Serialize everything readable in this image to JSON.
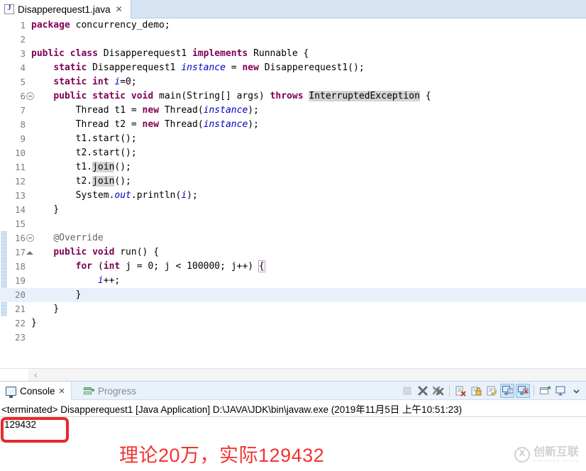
{
  "editor": {
    "tab": {
      "label": "Disapperequest1.java",
      "close_glyph": "✕",
      "icon": "java-file-icon"
    },
    "current_line": 20,
    "change_bar_lines": [
      16,
      21
    ],
    "lines": [
      {
        "num": "1",
        "fold": "none",
        "segments": [
          {
            "t": "package ",
            "c": "kw"
          },
          {
            "t": "concurrency_demo;",
            "c": "plain"
          }
        ]
      },
      {
        "num": "2",
        "fold": "none",
        "segments": []
      },
      {
        "num": "3",
        "fold": "none",
        "segments": [
          {
            "t": "public class ",
            "c": "kw"
          },
          {
            "t": "Disapperequest1 ",
            "c": "plain"
          },
          {
            "t": "implements ",
            "c": "kw"
          },
          {
            "t": "Runnable {",
            "c": "plain"
          }
        ]
      },
      {
        "num": "4",
        "fold": "none",
        "segments": [
          {
            "t": "    ",
            "c": "plain"
          },
          {
            "t": "static ",
            "c": "kw"
          },
          {
            "t": "Disapperequest1 ",
            "c": "plain"
          },
          {
            "t": "instance",
            "c": "fld"
          },
          {
            "t": " = ",
            "c": "plain"
          },
          {
            "t": "new ",
            "c": "kw"
          },
          {
            "t": "Disapperequest1();",
            "c": "plain"
          }
        ]
      },
      {
        "num": "5",
        "fold": "none",
        "segments": [
          {
            "t": "    ",
            "c": "plain"
          },
          {
            "t": "static int ",
            "c": "kw"
          },
          {
            "t": "i",
            "c": "fld"
          },
          {
            "t": "=0;",
            "c": "plain"
          }
        ]
      },
      {
        "num": "6",
        "fold": "collapse",
        "segments": [
          {
            "t": "    ",
            "c": "plain"
          },
          {
            "t": "public static void ",
            "c": "kw"
          },
          {
            "t": "main(String[] args) ",
            "c": "plain"
          },
          {
            "t": "throws ",
            "c": "kw"
          },
          {
            "t": "InterruptedException",
            "c": "hl"
          },
          {
            "t": " {",
            "c": "plain"
          }
        ]
      },
      {
        "num": "7",
        "fold": "none",
        "segments": [
          {
            "t": "        Thread t1 = ",
            "c": "plain"
          },
          {
            "t": "new ",
            "c": "kw"
          },
          {
            "t": "Thread(",
            "c": "plain"
          },
          {
            "t": "instance",
            "c": "fld"
          },
          {
            "t": ");",
            "c": "plain"
          }
        ]
      },
      {
        "num": "8",
        "fold": "none",
        "segments": [
          {
            "t": "        Thread t2 = ",
            "c": "plain"
          },
          {
            "t": "new ",
            "c": "kw"
          },
          {
            "t": "Thread(",
            "c": "plain"
          },
          {
            "t": "instance",
            "c": "fld"
          },
          {
            "t": ");",
            "c": "plain"
          }
        ]
      },
      {
        "num": "9",
        "fold": "none",
        "segments": [
          {
            "t": "        t1.start();",
            "c": "plain"
          }
        ]
      },
      {
        "num": "10",
        "fold": "none",
        "segments": [
          {
            "t": "        t2.start();",
            "c": "plain"
          }
        ]
      },
      {
        "num": "11",
        "fold": "none",
        "segments": [
          {
            "t": "        t1.",
            "c": "plain"
          },
          {
            "t": "join",
            "c": "hl"
          },
          {
            "t": "();",
            "c": "plain"
          }
        ]
      },
      {
        "num": "12",
        "fold": "none",
        "segments": [
          {
            "t": "        t2.",
            "c": "plain"
          },
          {
            "t": "join",
            "c": "hl"
          },
          {
            "t": "();",
            "c": "plain"
          }
        ]
      },
      {
        "num": "13",
        "fold": "none",
        "segments": [
          {
            "t": "        System.",
            "c": "plain"
          },
          {
            "t": "out",
            "c": "sfld"
          },
          {
            "t": ".println(",
            "c": "plain"
          },
          {
            "t": "i",
            "c": "fld"
          },
          {
            "t": ");",
            "c": "plain"
          }
        ]
      },
      {
        "num": "14",
        "fold": "none",
        "segments": [
          {
            "t": "    }",
            "c": "plain"
          }
        ]
      },
      {
        "num": "15",
        "fold": "none",
        "segments": []
      },
      {
        "num": "16",
        "fold": "collapse",
        "segments": [
          {
            "t": "    ",
            "c": "plain"
          },
          {
            "t": "@Override",
            "c": "ann"
          }
        ]
      },
      {
        "num": "17",
        "fold": "arrow",
        "segments": [
          {
            "t": "    ",
            "c": "plain"
          },
          {
            "t": "public void ",
            "c": "kw"
          },
          {
            "t": "run() {",
            "c": "plain"
          }
        ]
      },
      {
        "num": "18",
        "fold": "none",
        "segments": [
          {
            "t": "        ",
            "c": "plain"
          },
          {
            "t": "for ",
            "c": "kw"
          },
          {
            "t": "(",
            "c": "plain"
          },
          {
            "t": "int ",
            "c": "kw"
          },
          {
            "t": "j = 0; j < 100000; j++) ",
            "c": "plain"
          },
          {
            "t": "{",
            "c": "brk"
          }
        ]
      },
      {
        "num": "19",
        "fold": "none",
        "segments": [
          {
            "t": "            ",
            "c": "plain"
          },
          {
            "t": "i",
            "c": "fld"
          },
          {
            "t": "++;",
            "c": "plain"
          }
        ]
      },
      {
        "num": "20",
        "fold": "none",
        "segments": [
          {
            "t": "        }",
            "c": "plain"
          }
        ]
      },
      {
        "num": "21",
        "fold": "none",
        "segments": [
          {
            "t": "    }",
            "c": "plain"
          }
        ]
      },
      {
        "num": "22",
        "fold": "none",
        "segments": [
          {
            "t": "}",
            "c": "plain"
          }
        ]
      },
      {
        "num": "23",
        "fold": "none",
        "segments": []
      }
    ],
    "hscroll": {
      "left_arrow": "‹"
    }
  },
  "panel": {
    "tabs": [
      {
        "label": "Console",
        "icon": "console-icon",
        "active": true,
        "close_glyph": "✕"
      },
      {
        "label": "Progress",
        "icon": "progress-icon",
        "active": false,
        "close_glyph": ""
      }
    ],
    "toolbar": [
      {
        "name": "terminate-button",
        "icon": "stop-square-icon",
        "toggled": false,
        "enabled": false
      },
      {
        "name": "remove-launch-button",
        "icon": "x-mark-icon",
        "toggled": false,
        "enabled": true
      },
      {
        "name": "remove-all-terminated-button",
        "icon": "double-x-mark-icon",
        "toggled": false,
        "enabled": true
      },
      {
        "name": "separator-1",
        "icon": "separator",
        "toggled": false,
        "enabled": true
      },
      {
        "name": "clear-console-button",
        "icon": "clear-console-icon",
        "toggled": false,
        "enabled": true
      },
      {
        "name": "scroll-lock-button",
        "icon": "lock-icon",
        "toggled": false,
        "enabled": true
      },
      {
        "name": "word-wrap-button",
        "icon": "word-wrap-icon",
        "toggled": false,
        "enabled": true
      },
      {
        "name": "show-console-on-output-button",
        "icon": "console-output-icon",
        "toggled": true,
        "enabled": true
      },
      {
        "name": "show-console-on-error-button",
        "icon": "console-error-icon",
        "toggled": true,
        "enabled": true
      },
      {
        "name": "separator-2",
        "icon": "separator",
        "toggled": false,
        "enabled": true
      },
      {
        "name": "pin-console-button",
        "icon": "pin-console-icon",
        "toggled": false,
        "enabled": true
      },
      {
        "name": "display-selected-console-button",
        "icon": "display-console-icon",
        "toggled": false,
        "enabled": true
      },
      {
        "name": "console-menu-button",
        "icon": "chevron-down-icon",
        "toggled": false,
        "enabled": true
      }
    ],
    "console": {
      "process_line": "<terminated> Disapperequest1 [Java Application] D:\\JAVA\\JDK\\bin\\javaw.exe (2019年11月5日 上午10:51:23)",
      "output": "129432"
    }
  },
  "annotation": {
    "text": "理论20万，实际129432",
    "color": "#f2332f",
    "highlight_box_color": "#e8292b"
  },
  "watermark": {
    "cn": "创新互联",
    "en": "CHUANGXIN HULIAN",
    "logo": "circle-x-logo"
  }
}
